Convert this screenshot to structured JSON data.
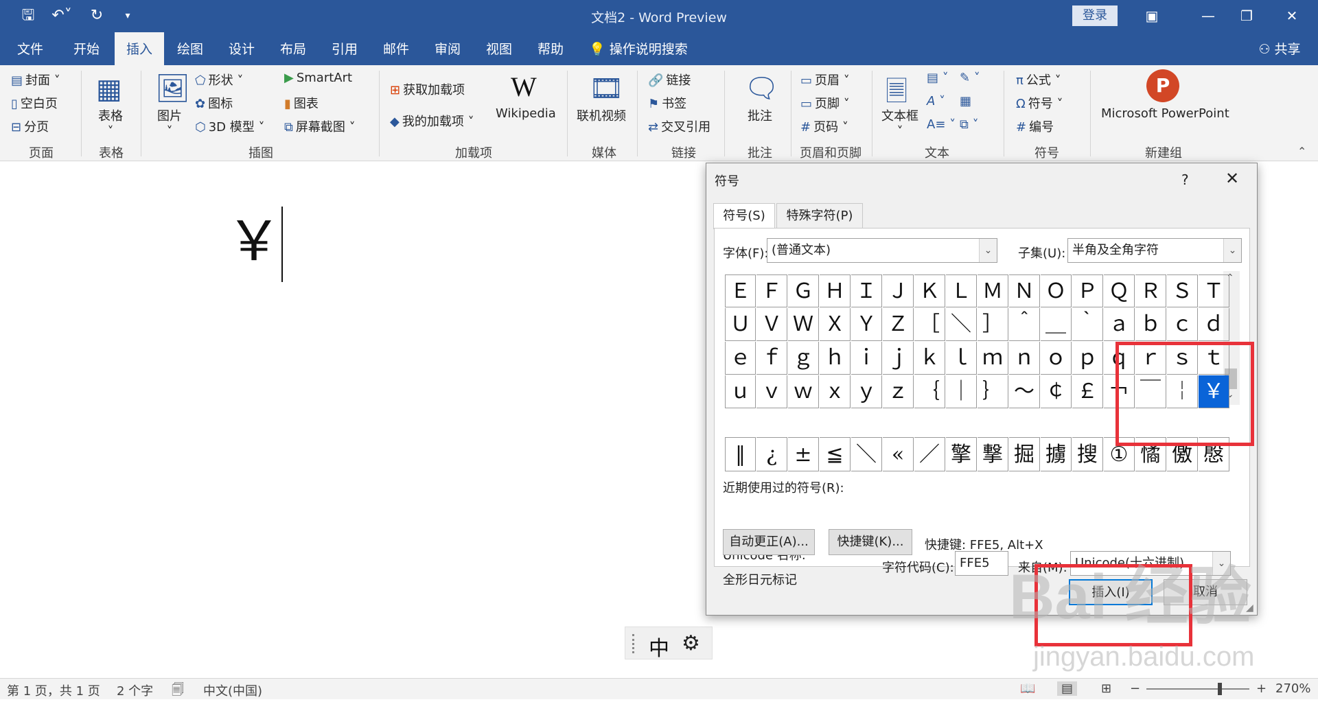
{
  "app": {
    "doc_title": "文档2 - Word Preview",
    "login": "登录",
    "share": "共享"
  },
  "menu_tabs": [
    "文件",
    "开始",
    "插入",
    "绘图",
    "设计",
    "布局",
    "引用",
    "邮件",
    "审阅",
    "视图",
    "帮助"
  ],
  "tell_me": "操作说明搜索",
  "ribbon": {
    "pages": {
      "cover": "封面",
      "blank": "空白页",
      "break": "分页",
      "label": "页面"
    },
    "tables": {
      "table": "表格",
      "label": "表格"
    },
    "illustrations": {
      "picture": "图片",
      "shapes": "形状",
      "icons": "图标",
      "model3d": "3D 模型",
      "smartart": "SmartArt",
      "chart": "图表",
      "screenshot": "屏幕截图",
      "label": "插图"
    },
    "addins": {
      "get": "获取加载项",
      "mine": "我的加载项",
      "wikipedia": "Wikipedia",
      "label": "加载项"
    },
    "media": {
      "video": "联机视频",
      "label": "媒体"
    },
    "links": {
      "link": "链接",
      "bookmark": "书签",
      "crossref": "交叉引用",
      "label": "链接"
    },
    "comments": {
      "comment": "批注",
      "label": "批注"
    },
    "header_footer": {
      "header": "页眉",
      "footer": "页脚",
      "page_number": "页码",
      "label": "页眉和页脚"
    },
    "text": {
      "textbox": "文本框",
      "label": "文本"
    },
    "symbols": {
      "equation": "公式",
      "symbol": "符号",
      "number": "编号",
      "label": "符号"
    },
    "newgroup": {
      "ppt": "Microsoft PowerPoint",
      "label": "新建组"
    }
  },
  "document": {
    "content": "￥"
  },
  "ime": {
    "mode": "中"
  },
  "dialog": {
    "title": "符号",
    "help": "?",
    "tab_symbols": "符号(S)",
    "tab_special": "特殊字符(P)",
    "font_label": "字体(F):",
    "font_value": "(普通文本)",
    "subset_label": "子集(U):",
    "subset_value": "半角及全角字符",
    "grid": [
      [
        "Ｅ",
        "Ｆ",
        "Ｇ",
        "Ｈ",
        "Ｉ",
        "Ｊ",
        "Ｋ",
        "Ｌ",
        "Ｍ",
        "Ｎ",
        "Ｏ",
        "Ｐ",
        "Ｑ",
        "Ｒ",
        "Ｓ",
        "Ｔ"
      ],
      [
        "Ｕ",
        "Ｖ",
        "Ｗ",
        "Ｘ",
        "Ｙ",
        "Ｚ",
        "［",
        "＼",
        "］",
        "＾",
        "＿",
        "｀",
        "ａ",
        "ｂ",
        "ｃ",
        "ｄ"
      ],
      [
        "ｅ",
        "ｆ",
        "ｇ",
        "ｈ",
        "ｉ",
        "ｊ",
        "ｋ",
        "ｌ",
        "ｍ",
        "ｎ",
        "ｏ",
        "ｐ",
        "ｑ",
        "ｒ",
        "ｓ",
        "ｔ"
      ],
      [
        "ｕ",
        "ｖ",
        "ｗ",
        "ｘ",
        "ｙ",
        "ｚ",
        "｛",
        "｜",
        "｝",
        "～",
        "￠",
        "￡",
        "￢",
        "￣",
        "￤",
        "￥"
      ]
    ],
    "recent_label": "近期使用过的符号(R):",
    "recent": [
      "‖",
      "¿",
      "±",
      "≦",
      "＼",
      "«",
      "／",
      "擎",
      "撃",
      "掘",
      "擄",
      "搜",
      "①",
      "憰",
      "儌",
      "慇"
    ],
    "unicode_name_label": "Unicode 名称:",
    "unicode_name_value": "全形日元标记",
    "charcode_label": "字符代码(C):",
    "charcode_value": "FFE5",
    "from_label": "来自(M):",
    "from_value": "Unicode(十六进制)",
    "autocorrect": "自动更正(A)...",
    "shortcut_btn": "快捷键(K)...",
    "shortcut_text": "快捷键: FFE5, Alt+X",
    "insert": "插入(I)",
    "cancel": "取消"
  },
  "status": {
    "page": "第 1 页，共 1 页",
    "words": "2 个字",
    "lang": "中文(中国)",
    "zoom": "270%"
  },
  "watermark": {
    "brand": "Bai 经验",
    "url": "jingyan.baidu.com"
  },
  "colors": {
    "accent": "#2b579a",
    "selection": "#0a64d8",
    "annotation": "#e8323a"
  }
}
